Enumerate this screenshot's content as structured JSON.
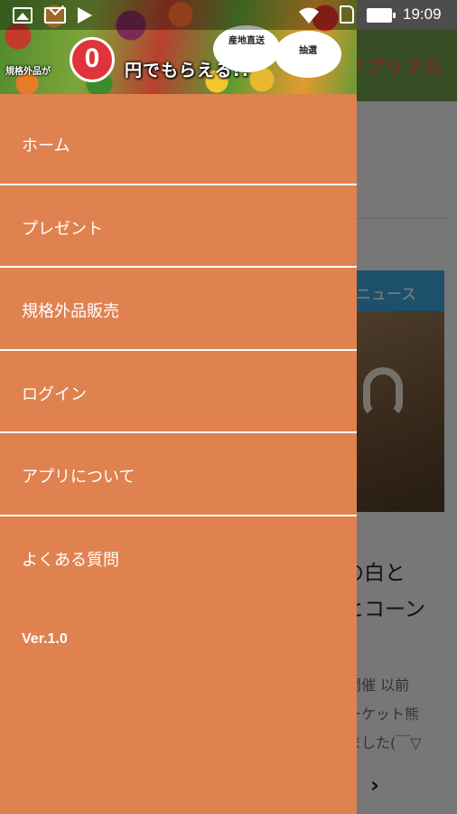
{
  "status_bar": {
    "time": "19:09",
    "icons": [
      "gallery-icon",
      "mail-icon",
      "play-store-icon",
      "wifi-icon",
      "sim-icon",
      "battery-icon"
    ]
  },
  "drawer": {
    "banner": {
      "promo_left": "規格外品が",
      "zero": "0",
      "headline": "円でもらえる!!",
      "burst_1": "産地直送",
      "burst_2": "抽選"
    },
    "menu_items": [
      {
        "label": "ホーム"
      },
      {
        "label": "プレゼント"
      },
      {
        "label": "規格外品販売"
      },
      {
        "label": "ログイン"
      },
      {
        "label": "アプリについて"
      },
      {
        "label": "よくある質問"
      }
    ],
    "version": "Ver.1.0"
  },
  "background_app": {
    "toolbar_title": "アプリアル",
    "news_label": "ニュース",
    "article_title_lines": [
      "の白と",
      "ヒコーン"
    ],
    "article_excerpt_lines": [
      "開催 以前",
      "ーケット熊",
      "ました(￣▽"
    ]
  },
  "colors": {
    "drawer_bg": "#df824f",
    "toolbar_green": "#6e9a4a",
    "news_blue": "#3aa3d6",
    "accent_red": "#e9623b"
  }
}
